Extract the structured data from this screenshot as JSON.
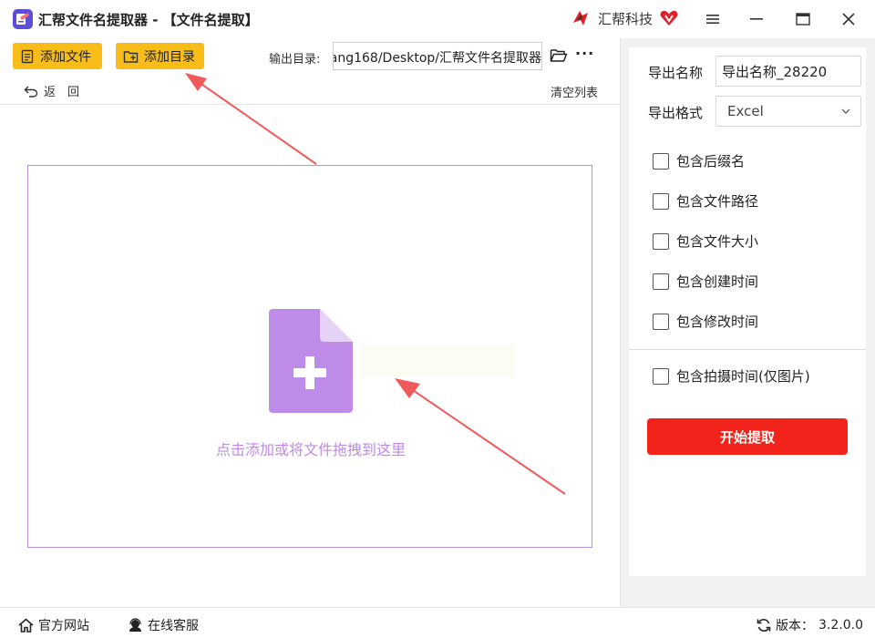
{
  "window": {
    "title": "汇帮文件名提取器 - 【文件名提取】",
    "brand": "汇帮科技",
    "minimize_icon": "menu-icon",
    "colors": {
      "accent_yellow": "#f8bd19",
      "start_red": "#f2231a",
      "dropzone_purple": "#c08ae6"
    }
  },
  "toolbar": {
    "add_file_label": "添加文件",
    "add_dir_label": "添加目录",
    "output_dir_label": "输出目录:",
    "output_dir_value": "ang168/Desktop/汇帮文件名提取器",
    "more_label": "···",
    "back_label": "返　回",
    "clear_label": "清空列表"
  },
  "dropzone": {
    "hint": "点击添加或将文件拖拽到这里"
  },
  "settings": {
    "export_name_label": "导出名称",
    "export_name_value": "导出名称_28220",
    "export_format_label": "导出格式",
    "export_format_value": "Excel",
    "options": [
      {
        "label": "包含后缀名",
        "checked": false
      },
      {
        "label": "包含文件路径",
        "checked": false
      },
      {
        "label": "包含文件大小",
        "checked": false
      },
      {
        "label": "包含创建时间",
        "checked": false
      },
      {
        "label": "包含修改时间",
        "checked": false
      },
      {
        "label": "包含拍摄时间(仅图片)",
        "checked": false
      }
    ],
    "start_label": "开始提取"
  },
  "statusbar": {
    "website_label": "官方网站",
    "support_label": "在线客服",
    "version_label": "版本：",
    "version_value": "3.2.0.0"
  }
}
